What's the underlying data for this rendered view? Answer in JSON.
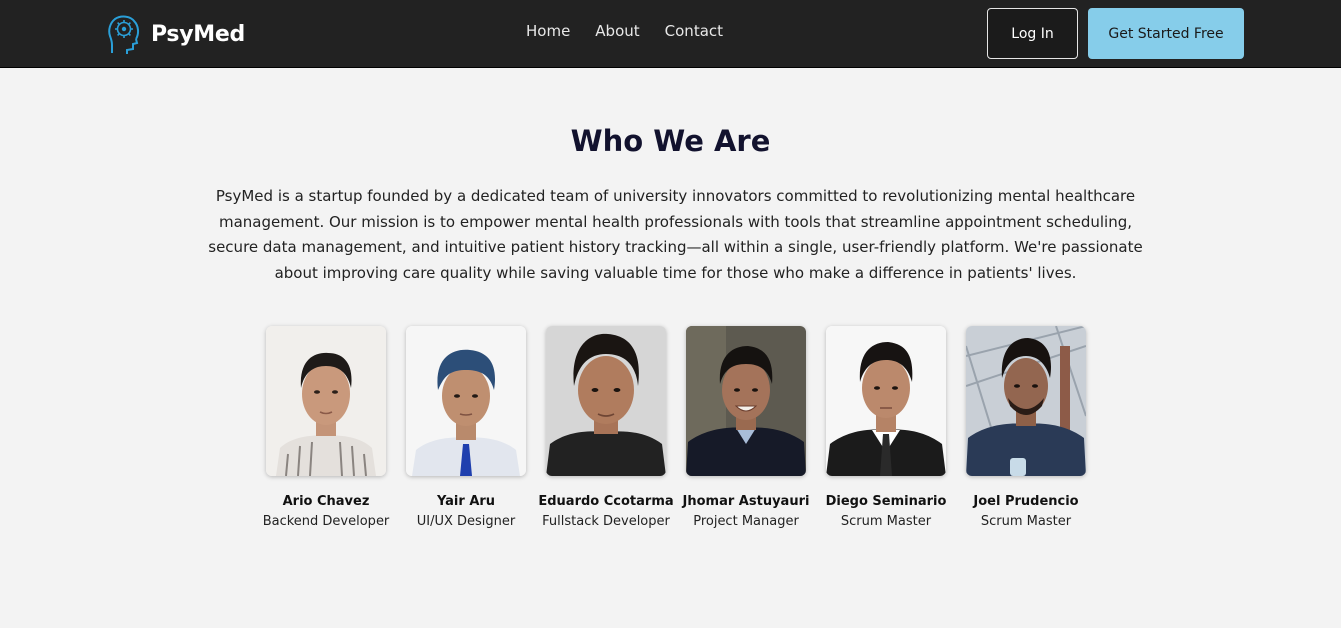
{
  "brand": {
    "name": "PsyMed",
    "icon": "brain-head-icon"
  },
  "nav": {
    "links": [
      "Home",
      "About",
      "Contact"
    ],
    "login_label": "Log In",
    "cta_label": "Get Started Free"
  },
  "colors": {
    "navbar_bg": "#222222",
    "page_bg": "#f3f3f3",
    "cta_bg": "#86cdea",
    "title": "#12122e",
    "logo_accent": "#2a9fd8"
  },
  "about": {
    "title": "Who We Are",
    "description": "PsyMed is a startup founded by a dedicated team of university innovators committed to revolutionizing mental healthcare management. Our mission is to empower mental health professionals with tools that streamline appointment scheduling, secure data management, and intuitive patient history tracking—all within a single, user-friendly platform. We're passionate about improving care quality while saving valuable time for those who make a difference in patients' lives."
  },
  "team": [
    {
      "name": "Ario Chavez",
      "role": "Backend Developer"
    },
    {
      "name": "Yair Aru",
      "role": "UI/UX Designer"
    },
    {
      "name": "Eduardo Ccotarma",
      "role": "Fullstack Developer"
    },
    {
      "name": "Jhomar Astuyauri",
      "role": "Project Manager"
    },
    {
      "name": "Diego Seminario",
      "role": "Scrum Master"
    },
    {
      "name": "Joel Prudencio",
      "role": "Scrum Master"
    }
  ]
}
